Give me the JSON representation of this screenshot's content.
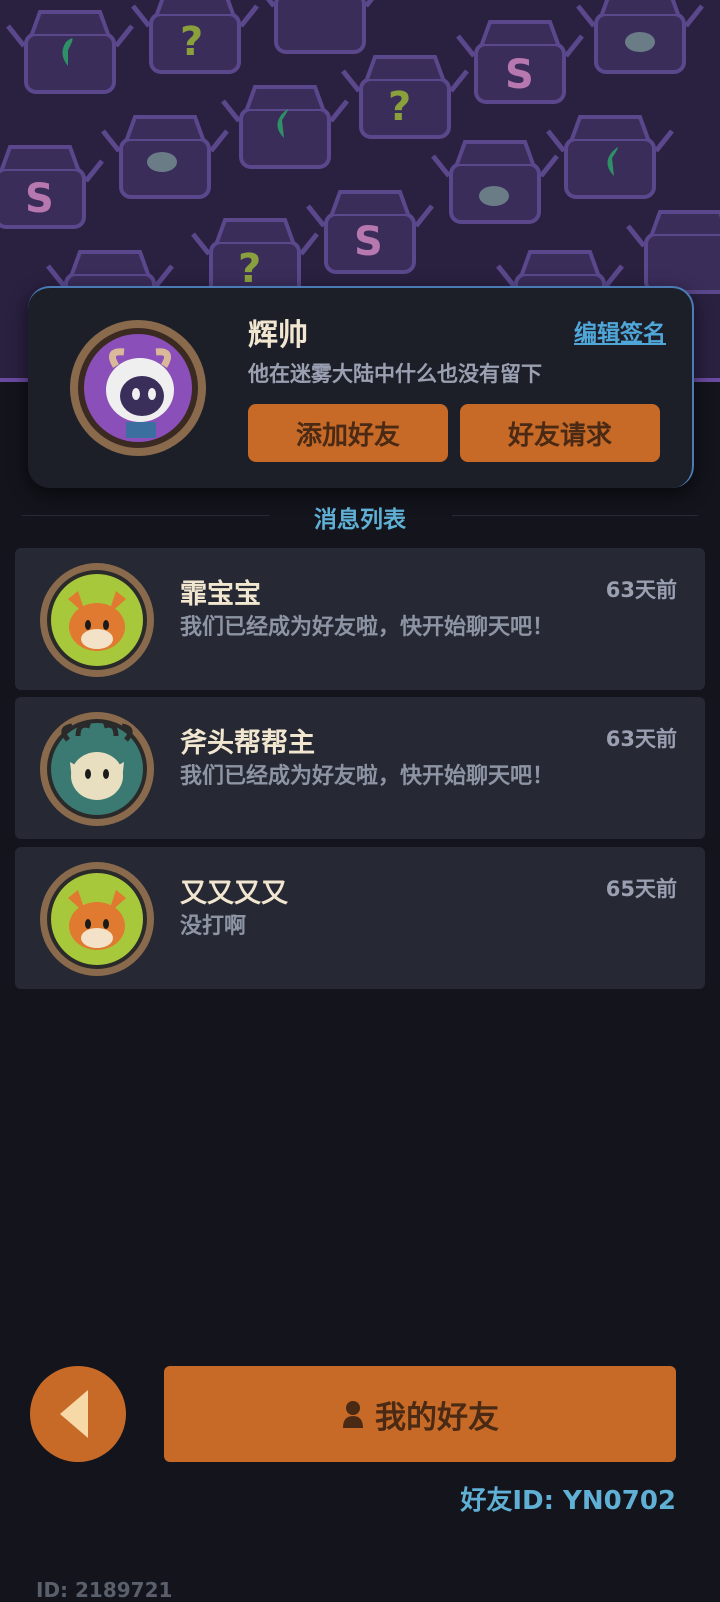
{
  "profile": {
    "name": "辉帅",
    "edit_signature_label": "编辑签名",
    "signature": "他在迷雾大陆中什么也没有留下",
    "add_friend_label": "添加好友",
    "friend_request_label": "好友请求",
    "avatar_icon": "sheep-avatar-icon"
  },
  "messages": {
    "section_title": "消息列表",
    "items": [
      {
        "name": "霏宝宝",
        "text": "我们已经成为好友啦，快开始聊天吧！",
        "time": "63天前",
        "avatar_icon": "fox-avatar-icon"
      },
      {
        "name": "斧头帮帮主",
        "text": "我们已经成为好友啦，快开始聊天吧！",
        "time": "63天前",
        "avatar_icon": "antler-cat-avatar-icon"
      },
      {
        "name": "又又又又",
        "text": "没打啊",
        "time": "65天前",
        "avatar_icon": "fox-avatar-icon"
      }
    ]
  },
  "footer": {
    "my_friends_label": "我的好友",
    "friend_id": "好友ID: YN0702",
    "user_id": "ID: 2189721"
  },
  "colors": {
    "accent": "#c86a27",
    "link": "#4fa6d8",
    "background": "#13141c"
  }
}
